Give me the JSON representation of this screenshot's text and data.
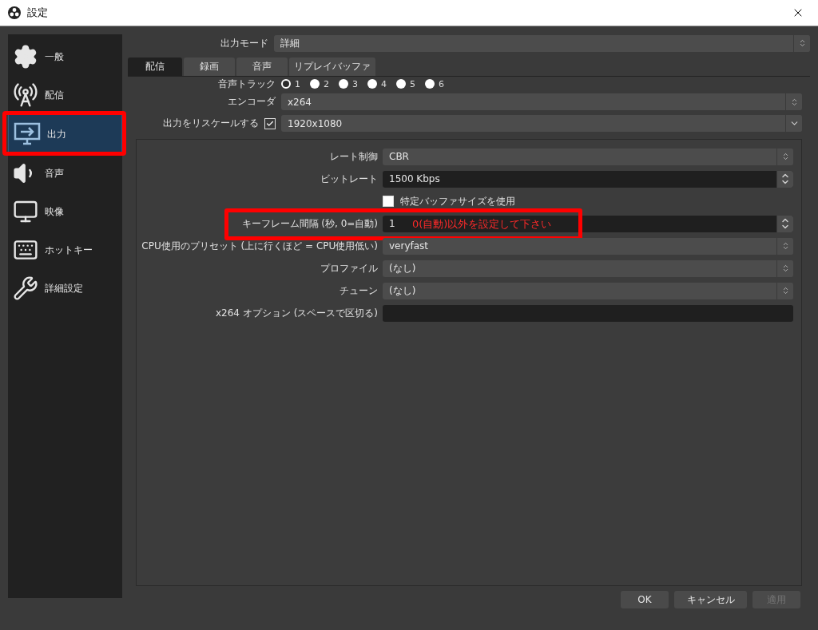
{
  "window": {
    "title": "設定"
  },
  "sidebar": {
    "items": [
      {
        "label": "一般",
        "selected": false
      },
      {
        "label": "配信",
        "selected": false
      },
      {
        "label": "出力",
        "selected": true,
        "highlighted": true
      },
      {
        "label": "音声",
        "selected": false
      },
      {
        "label": "映像",
        "selected": false
      },
      {
        "label": "ホットキー",
        "selected": false
      },
      {
        "label": "詳細設定",
        "selected": false
      }
    ]
  },
  "output_mode": {
    "label": "出力モード",
    "value": "詳細"
  },
  "tabs": [
    {
      "label": "配信",
      "selected": true
    },
    {
      "label": "録画",
      "selected": false
    },
    {
      "label": "音声",
      "selected": false
    },
    {
      "label": "リプレイバッファ",
      "selected": false
    }
  ],
  "audio_track": {
    "label": "音声トラック",
    "options": [
      {
        "label": "1",
        "selected": true
      },
      {
        "label": "2",
        "selected": false
      },
      {
        "label": "3",
        "selected": false
      },
      {
        "label": "4",
        "selected": false
      },
      {
        "label": "5",
        "selected": false
      },
      {
        "label": "6",
        "selected": false
      }
    ]
  },
  "encoder": {
    "label": "エンコーダ",
    "value": "x264"
  },
  "rescale": {
    "label": "出力をリスケールする",
    "checked": true,
    "value": "1920x1080"
  },
  "settings": [
    {
      "kind": "combo",
      "label": "レート制御",
      "value": "CBR"
    },
    {
      "kind": "spin",
      "label": "ビットレート",
      "value": "1500 Kbps"
    },
    {
      "kind": "checkbox",
      "label": "特定バッファサイズを使用",
      "checked": false
    },
    {
      "kind": "spin",
      "label": "キーフレーム間隔 (秒, 0=自動)",
      "value": "1",
      "highlighted": true,
      "note": "0(自動)以外を設定して下さい"
    },
    {
      "kind": "combo",
      "label": "CPU使用のプリセット (上に行くほど = CPU使用低い)",
      "value": "veryfast"
    },
    {
      "kind": "combo",
      "label": "プロファイル",
      "value": "(なし)"
    },
    {
      "kind": "combo",
      "label": "チューン",
      "value": "(なし)"
    },
    {
      "kind": "text",
      "label": "x264 オプション (スペースで区切る)"
    }
  ],
  "buttons": [
    {
      "label": "OK",
      "disabled": false
    },
    {
      "label": "キャンセル",
      "disabled": false
    },
    {
      "label": "適用",
      "disabled": true
    }
  ]
}
